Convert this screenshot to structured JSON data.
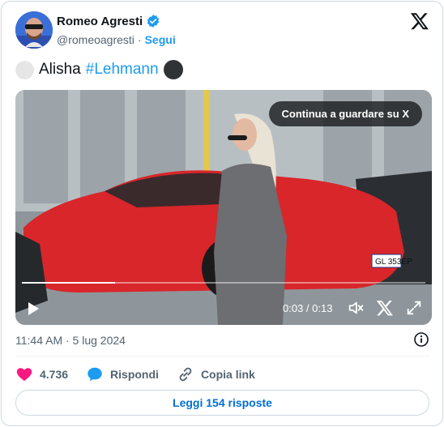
{
  "author": {
    "name": "Romeo Agresti",
    "handle": "@romeoagresti",
    "separator": "·",
    "follow_label": "Segui"
  },
  "tweet": {
    "text_prefix": "Alisha",
    "hashtag": "#Lehmann"
  },
  "video": {
    "overlay_label": "Continua a guardare su X",
    "time_display": "0:03 / 0:13",
    "progress_fraction": 0.23,
    "plate_text": "GL 353EP"
  },
  "timestamp": "11:44 AM · 5 lug 2024",
  "actions": {
    "like_count": "4.736",
    "reply_label": "Rispondi",
    "copy_link_label": "Copia link"
  },
  "read_replies_label": "Leggi 154 risposte",
  "colors": {
    "accent": "#1d9bf0",
    "like": "#f91880",
    "muted": "#536471"
  },
  "icons": [
    "verified-badge-icon",
    "x-logo-icon",
    "play-icon",
    "volume-icon",
    "x-small-icon",
    "fullscreen-icon",
    "info-icon",
    "heart-icon",
    "reply-bubble-icon",
    "link-icon"
  ]
}
